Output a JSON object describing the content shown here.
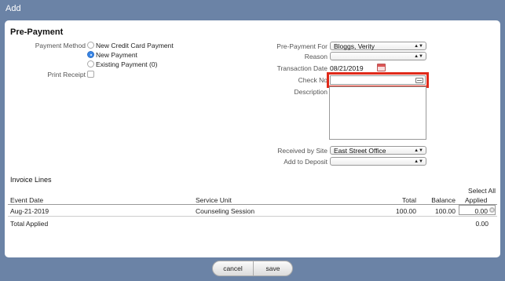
{
  "window": {
    "title": "Add"
  },
  "section": {
    "title": "Pre-Payment"
  },
  "payment_method": {
    "label": "Payment Method",
    "options": [
      {
        "label": "New Credit Card Payment",
        "selected": false
      },
      {
        "label": "New Payment",
        "selected": true
      },
      {
        "label": "Existing Payment (0)",
        "selected": false
      }
    ]
  },
  "print_receipt": {
    "label": "Print Receipt",
    "checked": false
  },
  "prepayment_for": {
    "label": "Pre-Payment For",
    "value": "Bloggs, Verity"
  },
  "reason": {
    "label": "Reason",
    "value": ""
  },
  "transaction_date": {
    "label": "Transaction Date",
    "value": "08/21/2019"
  },
  "check_no": {
    "label": "Check No",
    "value": "",
    "highlight_color": "#e02a1a"
  },
  "description": {
    "label": "Description",
    "value": ""
  },
  "received_by_site": {
    "label": "Received by Site",
    "value": "East Street Office"
  },
  "add_to_deposit": {
    "label": "Add to Deposit",
    "value": ""
  },
  "invoice_lines": {
    "title": "Invoice Lines",
    "select_all": "Select All",
    "columns": [
      "Event Date",
      "Service Unit",
      "Total",
      "Balance",
      "Applied"
    ],
    "rows": [
      {
        "event_date": "Aug-21-2019",
        "service_unit": "Counseling Session",
        "total": "100.00",
        "balance": "100.00",
        "applied": "0.00"
      }
    ],
    "total_applied_label": "Total Applied",
    "total_applied_value": "0.00"
  },
  "footer": {
    "cancel_label": "cancel",
    "save_label": "save"
  },
  "colors": {
    "header_bg": "#6b83a6",
    "radio_selected": "#3a86e6"
  }
}
